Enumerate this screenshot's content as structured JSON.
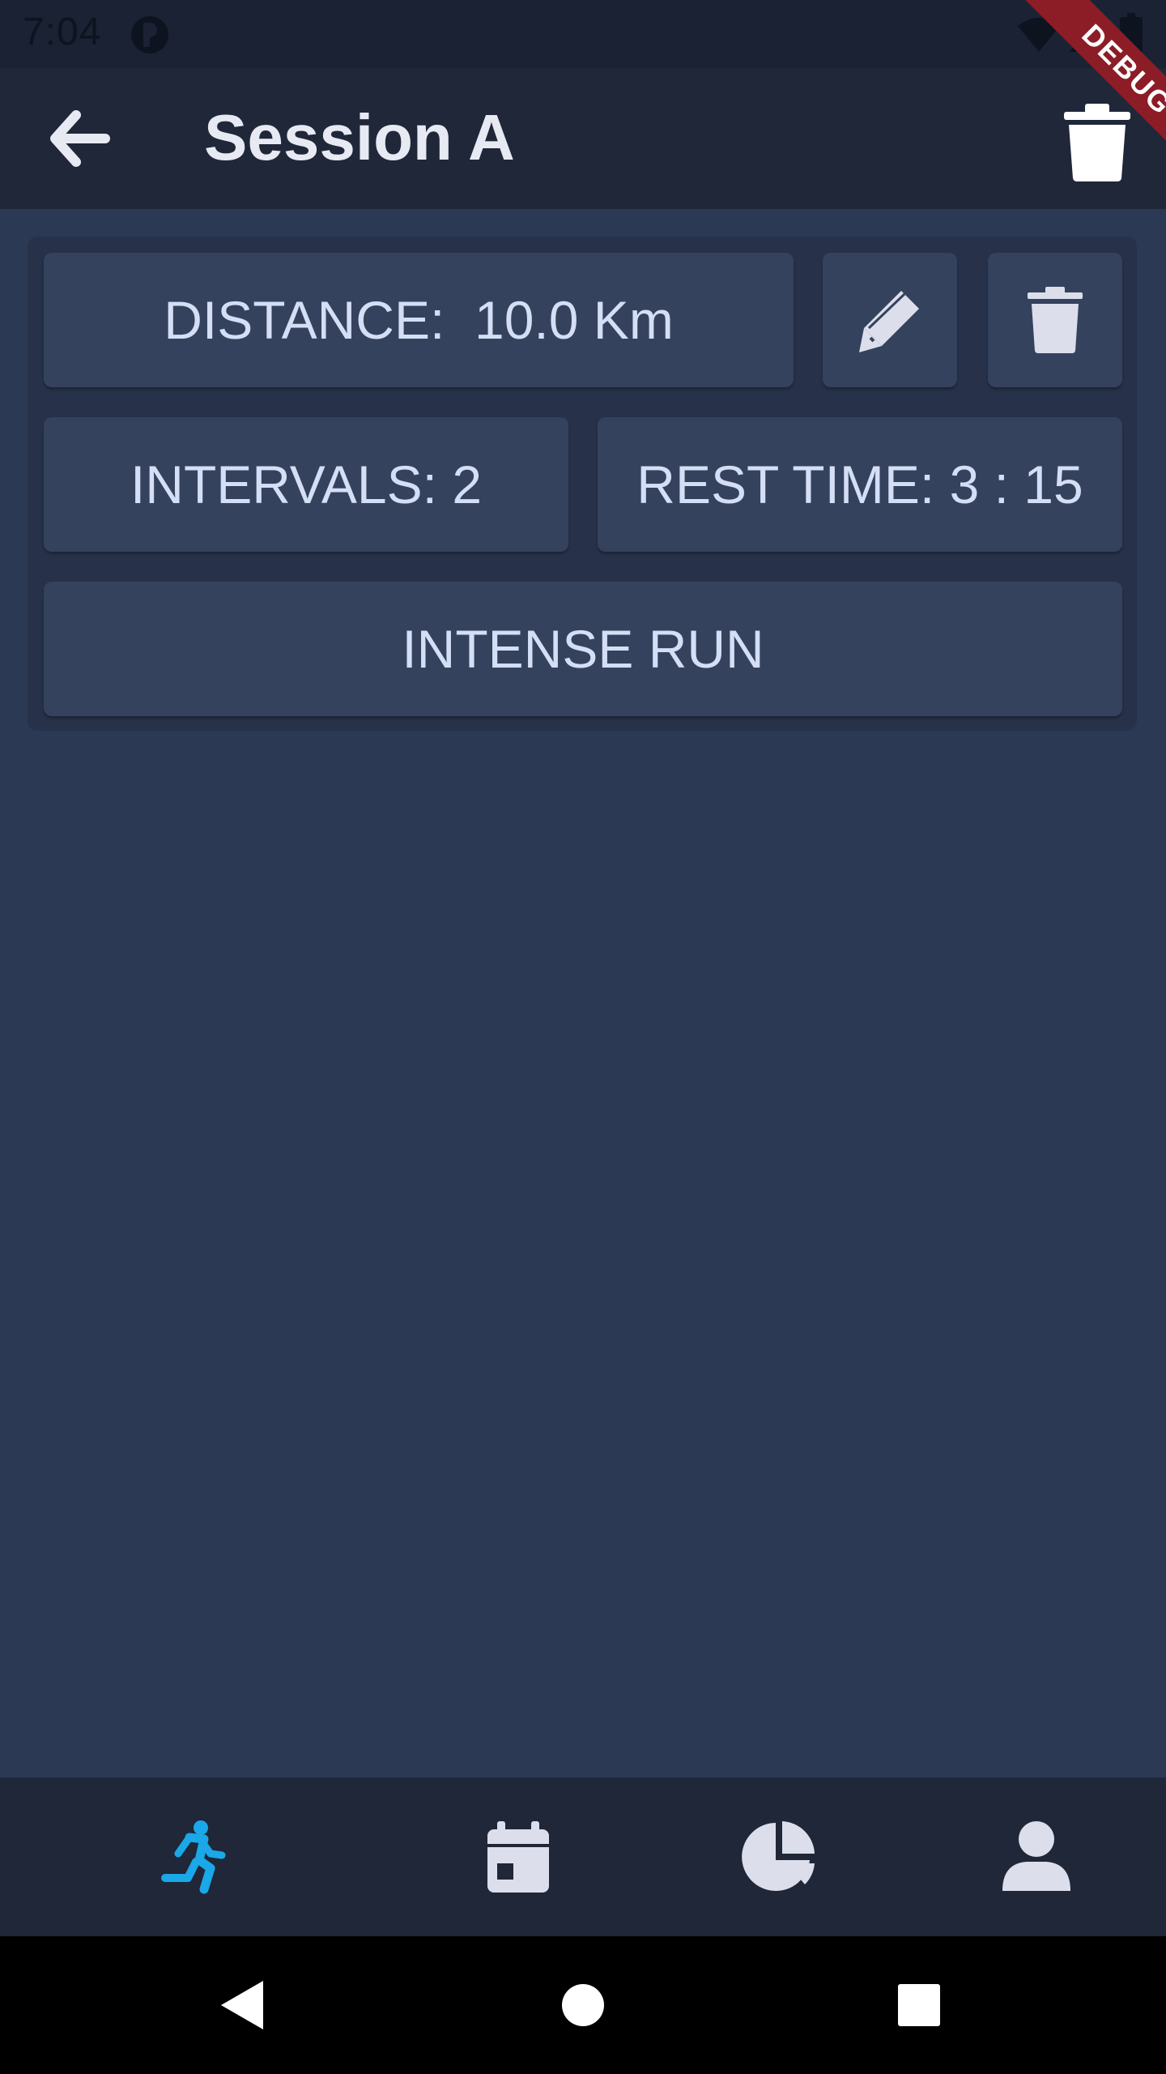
{
  "status_bar": {
    "time": "7:04",
    "icons": [
      "app-notification-icon",
      "wifi-icon",
      "cell-signal-icon",
      "battery-icon"
    ]
  },
  "app_bar": {
    "title": "Session A",
    "back_icon": "arrow-left-icon",
    "action_icon": "trash-icon"
  },
  "debug_banner": "DEBUG",
  "session": {
    "distance_label": "DISTANCE:  10.0 Km",
    "intervals_label": "INTERVALS: 2",
    "rest_time_label": "REST TIME: 3 : 15",
    "type_label": "INTENSE RUN",
    "edit_icon": "pencil-icon",
    "delete_icon": "trash-icon"
  },
  "bottom_nav": {
    "items": [
      {
        "icon": "running-person-icon",
        "active": true
      },
      {
        "icon": "calendar-icon",
        "active": false
      },
      {
        "icon": "pie-chart-icon",
        "active": false
      },
      {
        "icon": "user-icon",
        "active": false
      }
    ]
  },
  "system_nav": [
    "back-triangle-icon",
    "home-circle-icon",
    "recents-square-icon"
  ],
  "colors": {
    "background": "#2c3954",
    "app_bar": "#1f2739",
    "card": "#27324a",
    "tile": "#35425e",
    "tile_text": "#d4def5",
    "title_text": "#e7eaf3",
    "active_nav": "#1aa8e8",
    "inactive_nav": "#dcdfeb",
    "debug_banner": "#8c1d27"
  }
}
